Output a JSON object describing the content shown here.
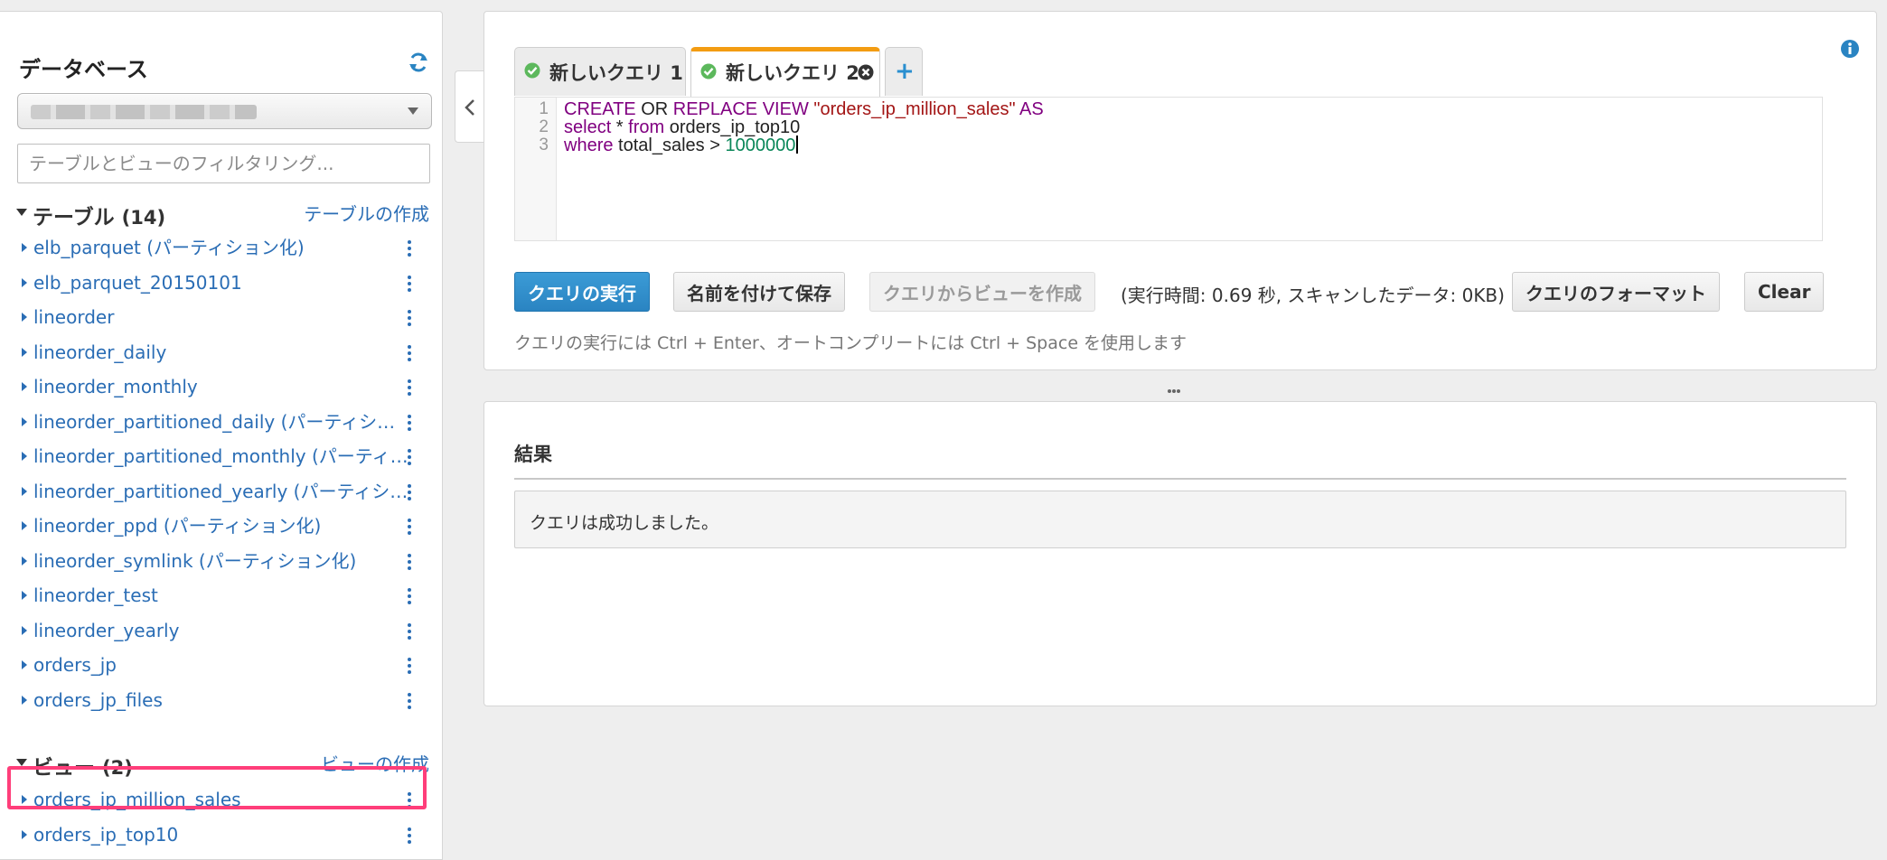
{
  "sidebar": {
    "title": "データベース",
    "filter_placeholder": "テーブルとビューのフィルタリング...",
    "tables_section": {
      "label": "テーブル",
      "count": "(14)",
      "create_link": "テーブルの作成",
      "items": [
        {
          "name": "elb_parquet (パーティション化)"
        },
        {
          "name": "elb_parquet_20150101"
        },
        {
          "name": "lineorder"
        },
        {
          "name": "lineorder_daily"
        },
        {
          "name": "lineorder_monthly"
        },
        {
          "name": "lineorder_partitioned_daily (パーティション化)"
        },
        {
          "name": "lineorder_partitioned_monthly (パーティション化)"
        },
        {
          "name": "lineorder_partitioned_yearly (パーティション化)"
        },
        {
          "name": "lineorder_ppd (パーティション化)"
        },
        {
          "name": "lineorder_symlink (パーティション化)"
        },
        {
          "name": "lineorder_test"
        },
        {
          "name": "lineorder_yearly"
        },
        {
          "name": "orders_jp"
        },
        {
          "name": "orders_jp_files"
        }
      ]
    },
    "views_section": {
      "label": "ビュー",
      "count": "(2)",
      "create_link": "ビューの作成",
      "items": [
        {
          "name": "orders_ip_million_sales"
        },
        {
          "name": "orders_ip_top10"
        }
      ]
    }
  },
  "editor": {
    "tabs": [
      {
        "label": "新しいクエリ 1",
        "active": false
      },
      {
        "label": "新しいクエリ 2",
        "active": true
      }
    ],
    "code": {
      "line1": {
        "n": "1",
        "kw1": "CREATE",
        "t1": " OR ",
        "kw2": "REPLACE",
        "t2": " ",
        "kw3": "VIEW",
        "t3": " ",
        "str": "\"orders_ip_million_sales\"",
        "t4": " ",
        "kw4": "AS"
      },
      "line2": {
        "n": "2",
        "kw1": "select",
        "t1": " * ",
        "kw2": "from",
        "t2": " orders_ip_top10"
      },
      "line3": {
        "n": "3",
        "kw1": "where",
        "t1": " total_sales > ",
        "num": "1000000"
      }
    },
    "buttons": {
      "run": "クエリの実行",
      "save_as": "名前を付けて保存",
      "create_view": "クエリからビューを作成",
      "format": "クエリのフォーマット",
      "clear": "Clear"
    },
    "exec_info": "(実行時間: 0.69 秒, スキャンしたデータ: 0KB)",
    "hint": "クエリの実行には Ctrl + Enter、オートコンプリートには Ctrl + Space を使用します"
  },
  "results": {
    "title": "結果",
    "message": "クエリは成功しました。"
  },
  "colors": {
    "link": "#2a6db5",
    "primary_button": "#2a84c2",
    "active_tab_accent": "#f39c12",
    "highlight": "#ff3e7a",
    "success": "#5cb85c",
    "keyword": "#800080",
    "string": "#a31515",
    "number": "#098658"
  },
  "icons": {
    "refresh": "refresh-icon",
    "info": "info-icon",
    "check": "check-circle-icon",
    "close": "close-circle-icon",
    "add": "plus-icon",
    "collapse": "chevron-left-icon",
    "kebab": "kebab-menu-icon"
  }
}
